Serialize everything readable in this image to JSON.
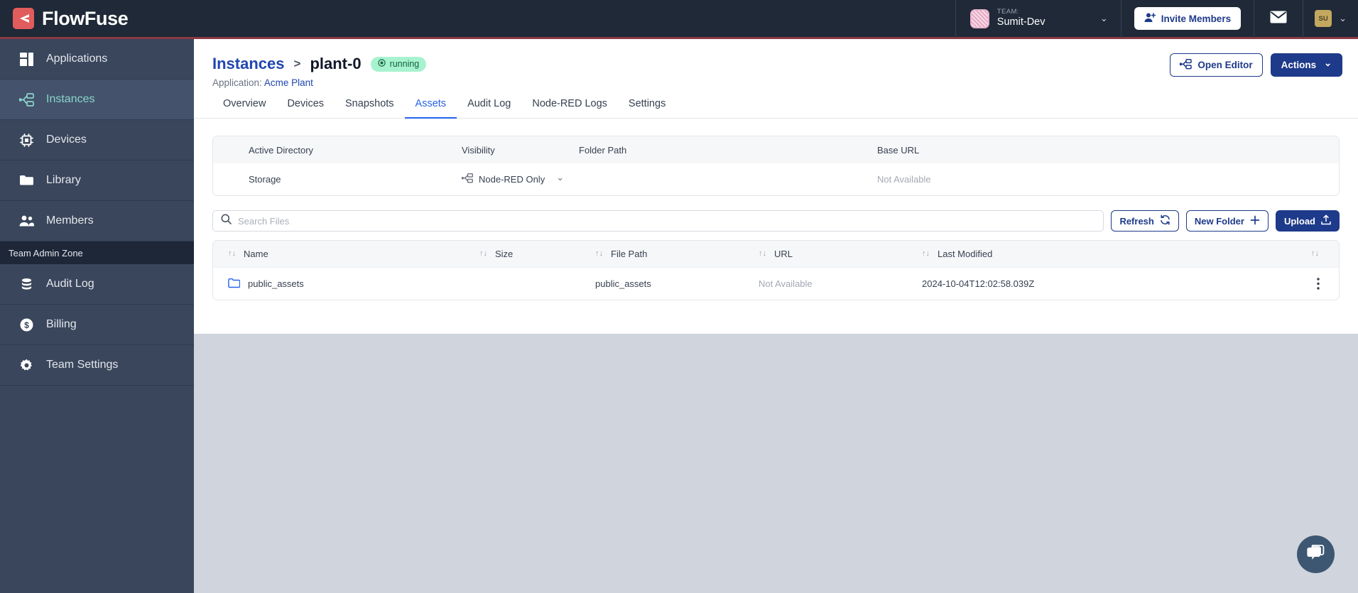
{
  "topnav": {
    "brand": "FlowFuse",
    "brand_mark_icon": "flowfuse-logo-icon",
    "team": {
      "label": "TEAM:",
      "name": "Sumit-Dev",
      "chevron": "⌄"
    },
    "invite_button": "Invite Members",
    "invite_icon": "add-user-icon",
    "mail_icon": "envelope-icon",
    "user_initials": "SU",
    "user_chevron": "⌄"
  },
  "sidebar": {
    "items": [
      {
        "label": "Applications",
        "icon": "applications-icon",
        "active": false
      },
      {
        "label": "Instances",
        "icon": "instances-icon",
        "active": true
      },
      {
        "label": "Devices",
        "icon": "devices-chip-icon",
        "active": false
      },
      {
        "label": "Library",
        "icon": "folder-icon",
        "active": false
      },
      {
        "label": "Members",
        "icon": "members-icon",
        "active": false
      }
    ],
    "zone_label": "Team Admin Zone",
    "admin_items": [
      {
        "label": "Audit Log",
        "icon": "database-icon"
      },
      {
        "label": "Billing",
        "icon": "dollar-circle-icon"
      },
      {
        "label": "Team Settings",
        "icon": "gear-icon"
      }
    ]
  },
  "page": {
    "breadcrumb_parent": "Instances",
    "breadcrumb_sep": ">",
    "breadcrumb_current": "plant-0",
    "status_badge": "running",
    "status_icon": "running-dot-icon",
    "application_prefix": "Application:",
    "application_name": "Acme Plant",
    "open_editor_button": "Open Editor",
    "open_editor_icon": "editor-nodes-icon",
    "actions_button": "Actions",
    "actions_chevron": "⌄"
  },
  "tabs": [
    {
      "label": "Overview",
      "active": false
    },
    {
      "label": "Devices",
      "active": false
    },
    {
      "label": "Snapshots",
      "active": false
    },
    {
      "label": "Assets",
      "active": true
    },
    {
      "label": "Audit Log",
      "active": false
    },
    {
      "label": "Node-RED Logs",
      "active": false
    },
    {
      "label": "Settings",
      "active": false
    }
  ],
  "directory_panel": {
    "headers": [
      "Active Directory",
      "Visibility",
      "Folder Path",
      "Base URL"
    ],
    "row": {
      "active_directory": "Storage",
      "visibility": "Node-RED Only",
      "visibility_icon": "nodered-icon",
      "visibility_chevron": "⌄",
      "folder_path": "",
      "base_url": "Not Available"
    }
  },
  "toolbar": {
    "search_placeholder": "Search Files",
    "search_value": "",
    "search_icon": "search-icon",
    "refresh_button": "Refresh",
    "refresh_icon": "refresh-icon",
    "new_folder_button": "New Folder",
    "new_folder_icon": "plus-icon",
    "upload_button": "Upload",
    "upload_icon": "upload-icon"
  },
  "files_table": {
    "columns": [
      "Name",
      "Size",
      "File Path",
      "URL",
      "Last Modified"
    ],
    "sort_icon": "↑↓",
    "rows": [
      {
        "icon": "folder-icon",
        "name": "public_assets",
        "size": "",
        "file_path": "public_assets",
        "url": "Not Available",
        "last_modified": "2024-10-04T12:02:58.039Z",
        "menu_icon": "kebab-menu-icon"
      }
    ]
  },
  "chat_widget": {
    "icon": "chat-bubbles-icon"
  },
  "colors": {
    "nav_bg": "#1f2937",
    "nav_underline": "#8b3a44",
    "sidebar_bg": "#39465c",
    "sidebar_active": "#44536b",
    "accent_teal": "#8ad4cd",
    "brand_red": "#e15c5c",
    "primary_blue": "#1e3a8a",
    "link_blue": "#2046b0",
    "tab_active": "#2563eb",
    "badge_bg": "#a7f3cf",
    "badge_text": "#14603f",
    "page_bg": "#d0d4dc"
  }
}
